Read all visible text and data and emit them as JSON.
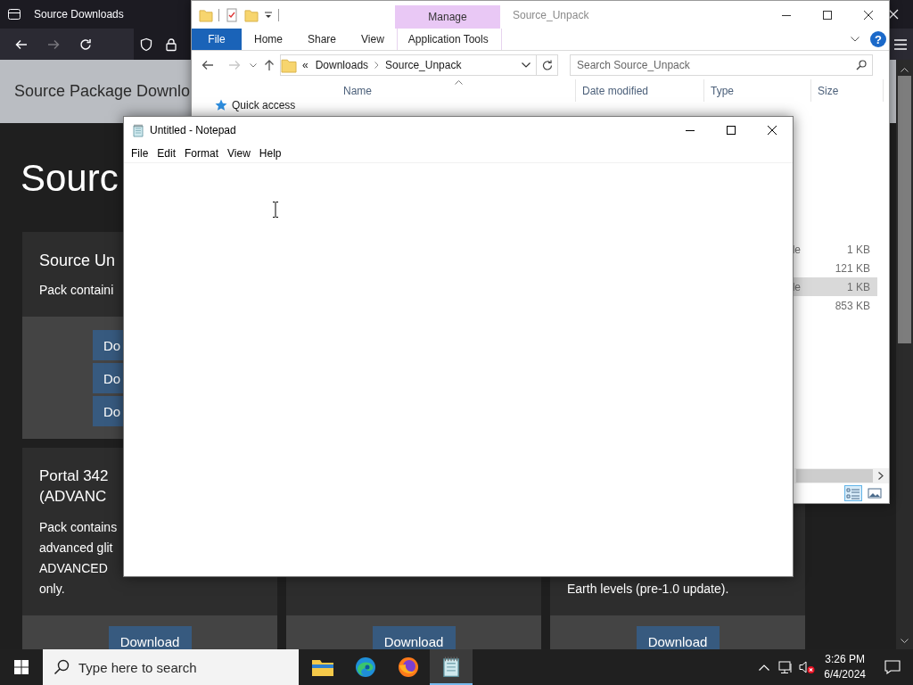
{
  "browser": {
    "tab_title": "Source Downloads",
    "page_header": "Source Package Downlo",
    "heading": "Sourc",
    "featured_card": {
      "title": "Source Un",
      "description": "Pack containi",
      "buttons": [
        "Do",
        "Do",
        "Do"
      ]
    },
    "cards": [
      {
        "title_lines": [
          "Portal 342",
          "(ADVANC"
        ],
        "description_lines": [
          "Pack contains",
          "advanced glit",
          "ADVANCED",
          "only."
        ],
        "button": "Download"
      },
      {
        "button": "Download"
      },
      {
        "description_lines": [
          "Earth levels (pre-1.0 update)."
        ],
        "button": "Download"
      }
    ]
  },
  "explorer": {
    "title": "Source_Unpack",
    "context_header": "Manage",
    "ribbon_tabs": [
      {
        "label": "File",
        "kind": "file"
      },
      {
        "label": "Home",
        "kind": "tab"
      },
      {
        "label": "Share",
        "kind": "tab"
      },
      {
        "label": "View",
        "kind": "tab"
      },
      {
        "label": "Application Tools",
        "kind": "contextual"
      }
    ],
    "help": "?",
    "path": {
      "overflow": "«",
      "crumbs": [
        "Downloads",
        "Source_Unpack"
      ]
    },
    "search": {
      "placeholder": "Search Source_Unpack"
    },
    "nav_pane": [
      {
        "label": "Quick access"
      }
    ],
    "columns": [
      "Name",
      "Date modified",
      "Type",
      "Size"
    ],
    "rows": [
      {
        "type": "le",
        "size": "1 KB",
        "selected": false
      },
      {
        "size": "121 KB",
        "selected": false
      },
      {
        "type": "le",
        "size": "1 KB",
        "selected": true
      },
      {
        "size": "853 KB",
        "selected": false
      }
    ]
  },
  "notepad": {
    "title": "Untitled - Notepad",
    "menu": [
      "File",
      "Edit",
      "Format",
      "View",
      "Help"
    ]
  },
  "taskbar": {
    "search": {
      "placeholder": "Type here to search"
    },
    "apps": [
      {
        "kind": "folder",
        "selected": false
      },
      {
        "kind": "swirl",
        "selected": false
      },
      {
        "kind": "flame",
        "selected": false
      },
      {
        "kind": "notepad",
        "selected": true
      }
    ],
    "time": "3:26 PM",
    "date": "6/4/2024"
  }
}
